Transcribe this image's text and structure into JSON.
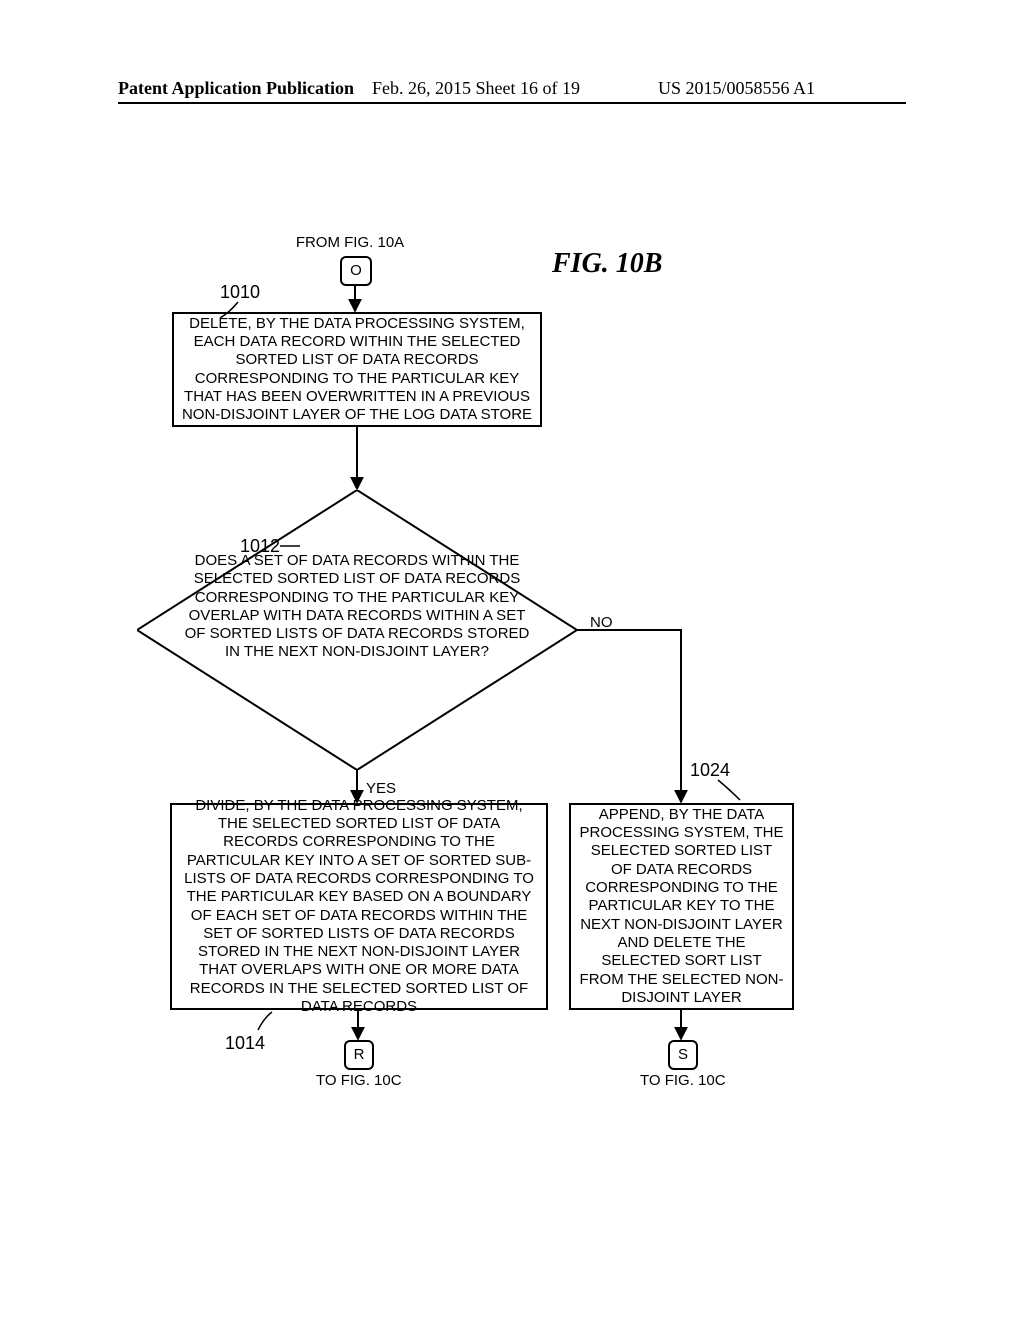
{
  "header": {
    "left": "Patent Application Publication",
    "mid": "Feb. 26, 2015  Sheet 16 of 19",
    "right": "US 2015/0058556 A1"
  },
  "figure_title": "FIG. 10B",
  "from_fig": "FROM FIG. 10A",
  "conn": {
    "O": "O",
    "R": "R",
    "S": "S"
  },
  "refs": {
    "r1010": "1010",
    "r1012": "1012",
    "r1014": "1014",
    "r1024": "1024"
  },
  "labels": {
    "yes": "YES",
    "no": "NO"
  },
  "to_fig": "TO FIG. 10C",
  "box1010": "DELETE, BY THE DATA PROCESSING SYSTEM, EACH DATA RECORD WITHIN THE SELECTED SORTED LIST OF DATA RECORDS CORRESPONDING TO THE PARTICULAR KEY THAT HAS BEEN OVERWRITTEN IN A PREVIOUS NON-DISJOINT LAYER OF THE LOG DATA STORE",
  "diamond1012": "DOES A SET OF DATA RECORDS WITHIN THE SELECTED SORTED LIST OF DATA RECORDS CORRESPONDING TO THE PARTICULAR KEY OVERLAP WITH DATA RECORDS WITHIN A SET OF SORTED LISTS OF DATA RECORDS STORED IN THE NEXT NON-DISJOINT LAYER?",
  "box1014": "DIVIDE, BY THE DATA PROCESSING SYSTEM, THE SELECTED SORTED LIST OF DATA RECORDS CORRESPONDING TO THE PARTICULAR KEY INTO A SET OF SORTED SUB-LISTS OF DATA RECORDS CORRESPONDING TO THE PARTICULAR KEY BASED ON A BOUNDARY OF EACH SET OF DATA RECORDS WITHIN THE SET OF SORTED LISTS OF DATA RECORDS STORED IN THE NEXT NON-DISJOINT LAYER THAT OVERLAPS WITH ONE OR MORE DATA RECORDS IN THE SELECTED SORTED LIST OF DATA RECORDS",
  "box1024": "APPEND, BY THE DATA PROCESSING SYSTEM, THE SELECTED SORTED LIST OF DATA RECORDS CORRESPONDING TO THE PARTICULAR KEY TO THE NEXT NON-DISJOINT LAYER AND DELETE THE SELECTED SORT LIST FROM THE SELECTED NON-DISJOINT LAYER"
}
